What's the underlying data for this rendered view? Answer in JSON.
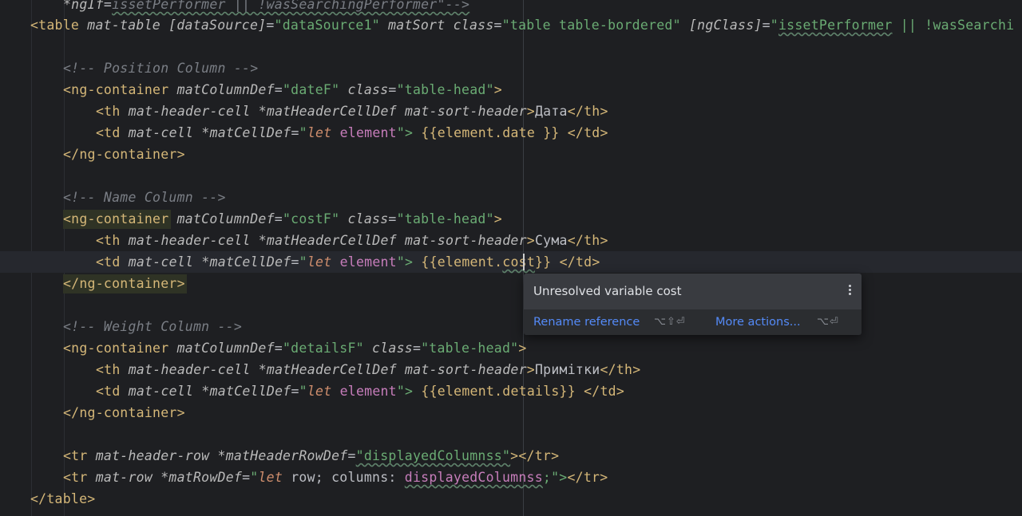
{
  "colors": {
    "background": "#1e1f22",
    "tag": "#d5b778",
    "attribute": "#bababa",
    "string": "#6aab73",
    "comment": "#7a7e85",
    "keyword": "#cf8e6d",
    "variable": "#c77dbb",
    "text": "#bcbec4",
    "link": "#548af7"
  },
  "code": {
    "l0": {
      "attr": "*ngIf",
      "val": "issetPerformer || !wasSearchingPerformer\"-->"
    },
    "l1": {
      "t1": "<table",
      "a1": "mat-table",
      "a2": "[dataSource]",
      "s1": "\"dataSource1\"",
      "a3": "matSort",
      "a4": "class",
      "s2": "\"table table-bordered\"",
      "a5": "[ngClass]",
      "s3a": "\"",
      "s3b": "issetPerformer",
      "s3c": " || !wasSearchi"
    },
    "l3": "<!-- Position Column -->",
    "l4": {
      "t": "<ng-container",
      "a1": "matColumnDef",
      "s1": "\"dateF\"",
      "a2": "class",
      "s2": "\"table-head\"",
      "e": ">"
    },
    "l5": {
      "t1": "<th",
      "a1": "mat-header-cell",
      "a2": "*matHeaderCellDef",
      "a3": "mat-sort-header",
      "g": ">",
      "txt": "Дата",
      "t2": "</th",
      "e": ">"
    },
    "l6": {
      "t1": "<td",
      "a1": "mat-cell",
      "a2": "*matCellDef",
      "q1": "\"",
      "k": "let",
      "v": "element",
      "q2": "\">",
      "ex": " {{element.date }} ",
      "t2": "</td",
      "e": ">"
    },
    "l7": {
      "t": "</ng-container",
      "e": ">"
    },
    "l9": "<!-- Name Column -->",
    "l10": {
      "t": "<ng-container",
      "a1": "matColumnDef",
      "s1": "\"costF\"",
      "a2": "class",
      "s2": "\"table-head\"",
      "e": ">"
    },
    "l11": {
      "t1": "<th",
      "a1": "mat-header-cell",
      "a2": "*matHeaderCellDef",
      "a3": "mat-sort-header",
      "g": ">",
      "txt": "Сума",
      "t2": "</th",
      "e": ">"
    },
    "l12": {
      "t1": "<td",
      "a1": "mat-cell",
      "a2": "*matCellDef",
      "q1": "\"",
      "k": "let",
      "v": "element",
      "q2": "\">",
      "ex1": " {{element.",
      "ex2": "cost",
      "ex3": "}} ",
      "t2": "</td",
      "e": ">"
    },
    "l13": {
      "t": "</ng-container",
      "e": ">"
    },
    "l15": "<!-- Weight Column -->",
    "l16": {
      "t": "<ng-container",
      "a1": "matColumnDef",
      "s1": "\"detailsF\"",
      "a2": "class",
      "s2": "\"table-head\"",
      "e": ">"
    },
    "l17": {
      "t1": "<th",
      "a1": "mat-header-cell",
      "a2": "*matHeaderCellDef",
      "a3": "mat-sort-header",
      "g": ">",
      "txt": "Примітки",
      "t2": "</th",
      "e": ">"
    },
    "l18": {
      "t1": "<td",
      "a1": "mat-cell",
      "a2": "*matCellDef",
      "q1": "\"",
      "k": "let",
      "v": "element",
      "q2": "\">",
      "ex": " {{element.details}} ",
      "t2": "</td",
      "e": ">"
    },
    "l19": {
      "t": "</ng-container",
      "e": ">"
    },
    "l21": {
      "t1": "<tr",
      "a1": "mat-header-row",
      "a2": "*matHeaderRowDef",
      "s1": "\"displayedColumnss\"",
      "g": ">",
      "t2": "</tr",
      "e": ">"
    },
    "l22": {
      "t1": "<tr",
      "a1": "mat-row",
      "a2": "*matRowDef",
      "q1": "\"",
      "k": "let",
      "p1": " row; columns: ",
      "v": "displayedColumnss",
      "q2": ";\">",
      "t2": "</tr",
      "e": ">"
    },
    "l23": {
      "t": "</table",
      "e": ">"
    }
  },
  "popup": {
    "message": "Unresolved variable cost",
    "rename_label": "Rename reference",
    "rename_shortcut": "⌥⇧⏎",
    "more_label": "More actions...",
    "more_shortcut": "⌥⏎"
  }
}
